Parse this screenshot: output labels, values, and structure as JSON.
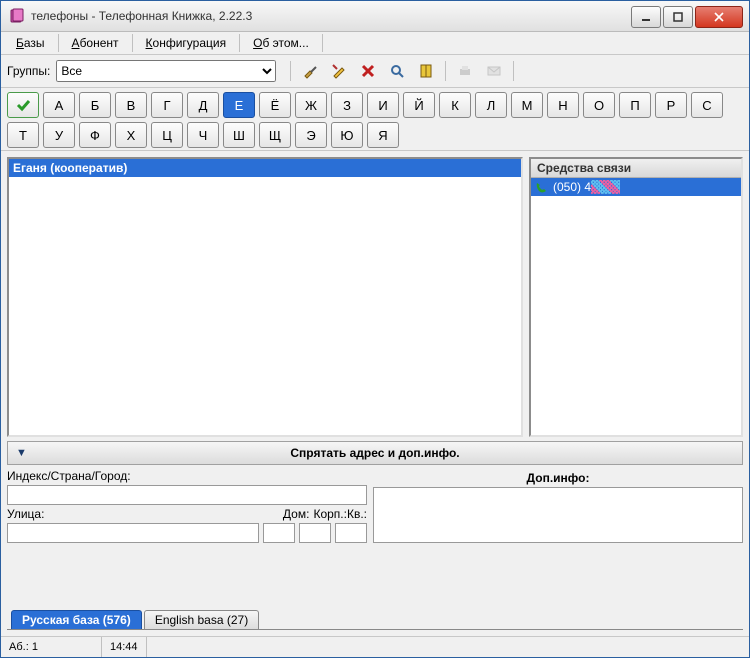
{
  "title": "телефоны - Телефонная Книжка, 2.22.3",
  "menu": {
    "bases": "Базы",
    "abonent": "Абонент",
    "config": "Конфигурация",
    "about": "Об этом..."
  },
  "groups": {
    "label": "Группы:",
    "selected": "Все",
    "options": [
      "Все"
    ]
  },
  "toolbar_icons": {
    "brush": "brush-icon",
    "pencil": "pencil-icon",
    "delete": "delete-icon",
    "search": "search-icon",
    "book": "book-icon",
    "print": "print-icon",
    "envelope": "envelope-icon"
  },
  "alphabet": [
    "А",
    "Б",
    "В",
    "Г",
    "Д",
    "Е",
    "Ё",
    "Ж",
    "З",
    "И",
    "Й",
    "К",
    "Л",
    "М",
    "Н",
    "О",
    "П",
    "Р",
    "С",
    "Т",
    "У",
    "Ф",
    "Х",
    "Ц",
    "Ч",
    "Ш",
    "Щ",
    "Э",
    "Ю",
    "Я"
  ],
  "alphabet_active": "Е",
  "list": {
    "selected": "Еганя (кооператив)"
  },
  "contact": {
    "header": "Средства связи",
    "phone": "(050) 4",
    "masked": "XXXXX"
  },
  "hidebar": "Спрятать адрес и доп.инфо.",
  "address": {
    "index_label": "Индекс/Страна/Город:",
    "index_value": "",
    "street_label": "Улица:",
    "street_value": "",
    "house_label": "Дом:",
    "house_value": "",
    "korp_kv_label": "Корп.:Кв.:",
    "korp_value": "",
    "kv_value": ""
  },
  "extra": {
    "label": "Доп.инфо:",
    "value": ""
  },
  "tabs": {
    "ru": "Русская база (576)",
    "en": "English basa (27)",
    "active": "ru"
  },
  "status": {
    "count_label": "Аб.:",
    "count": "1",
    "time": "14:44"
  }
}
